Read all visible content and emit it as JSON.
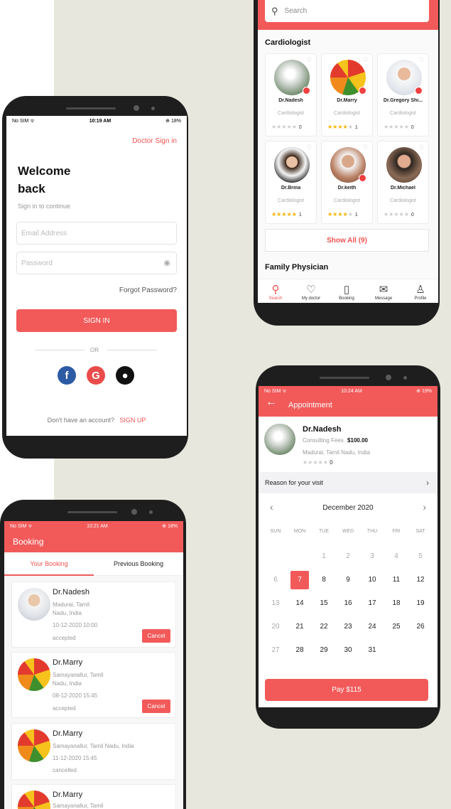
{
  "login": {
    "status_left": "No SIM ᯤ",
    "status_time": "10:19 AM",
    "status_right": "⊕ 18%",
    "doctor_signin": "Doctor Sign in",
    "welcome_line1": "Welcome",
    "welcome_line2": "back",
    "subtitle": "Sign in to continue",
    "email_placeholder": "Email Address",
    "password_placeholder": "Password",
    "forgot": "Forgot Password?",
    "signin_button": "SIGN IN",
    "or": "OR",
    "no_account": "Don't have an account?",
    "signup": "SIGN UP"
  },
  "doctors": {
    "search_placeholder": "Search",
    "section_title": "Cardiologist",
    "cards": [
      {
        "name": "Dr.Nadesh",
        "spec": "Cardiologist",
        "stars": 0,
        "count": "0"
      },
      {
        "name": "Dr.Marry",
        "spec": "Cardiologist",
        "stars": 4,
        "count": "1"
      },
      {
        "name": "Dr.Gregory Shi...",
        "spec": "Cardiologist",
        "stars": 0,
        "count": "0"
      },
      {
        "name": "Dr.Brina",
        "spec": "Cardiologist",
        "stars": 5,
        "count": "1"
      },
      {
        "name": "Dr.keith",
        "spec": "Cardiologist",
        "stars": 4,
        "count": "1"
      },
      {
        "name": "Dr.Michael",
        "spec": "Cardiologist",
        "stars": 0,
        "count": "0"
      }
    ],
    "show_all": "Show All (9)",
    "section2_title": "Family Physician",
    "nav": [
      "Search",
      "My doctor",
      "Booking",
      "Message",
      "Profile"
    ]
  },
  "appointment": {
    "status_left": "No SIM ᯤ",
    "status_time": "10:24 AM",
    "status_right": "⊕ 19%",
    "title": "Appointment",
    "doctor_name": "Dr.Nadesh",
    "fees_label": "Consulting Fees",
    "fees_value": "$100.00",
    "location": "Madurai, Tamil Nadu, India",
    "rating_count": "0",
    "reason": "Reason for your visit",
    "month": "December 2020",
    "weekdays": [
      "SUN",
      "MON",
      "TUE",
      "WED",
      "THU",
      "FRI",
      "SAT"
    ],
    "selected_day": "7",
    "pay_button": "Pay $115",
    "days_row1": [
      "1",
      "2",
      "3",
      "4",
      "5"
    ],
    "days_row2": [
      "6",
      "7",
      "8",
      "9",
      "10",
      "11",
      "12"
    ],
    "days_row3": [
      "13",
      "14",
      "15",
      "16",
      "17",
      "18",
      "19"
    ],
    "days_row4": [
      "20",
      "21",
      "22",
      "23",
      "24",
      "25",
      "26"
    ],
    "days_row5": [
      "27",
      "28",
      "29",
      "30",
      "31"
    ]
  },
  "booking": {
    "status_left": "No SIM ᯤ",
    "status_time": "10:21 AM",
    "status_right": "⊕ 18%",
    "title": "Booking",
    "tab_active": "Your Booking",
    "tab_inactive": "Previous Booking",
    "items": [
      {
        "name": "Dr.Nadesh",
        "addr1": "Madurai, Tamil",
        "addr2": "Nadu, India",
        "datetime": "10-12-2020 10:00",
        "status": "accepted",
        "cancel": "Cancel"
      },
      {
        "name": "Dr.Marry",
        "addr1": "Samayanallur, Tamil",
        "addr2": "Nadu, India",
        "datetime": "08-12-2020 15:45",
        "status": "accepted",
        "cancel": "Cancel"
      },
      {
        "name": "Dr.Marry",
        "addr1": "Samayanallur, Tamil Nadu, India",
        "datetime": "11-12-2020 15:45",
        "status": "cancelled"
      },
      {
        "name": "Dr.Marry",
        "addr1": "Samayanallur, Tamil"
      }
    ]
  },
  "colors": {
    "accent": "#f25a5a",
    "phone": "#1e1e1e",
    "backdrop": "#e8e7dd"
  }
}
